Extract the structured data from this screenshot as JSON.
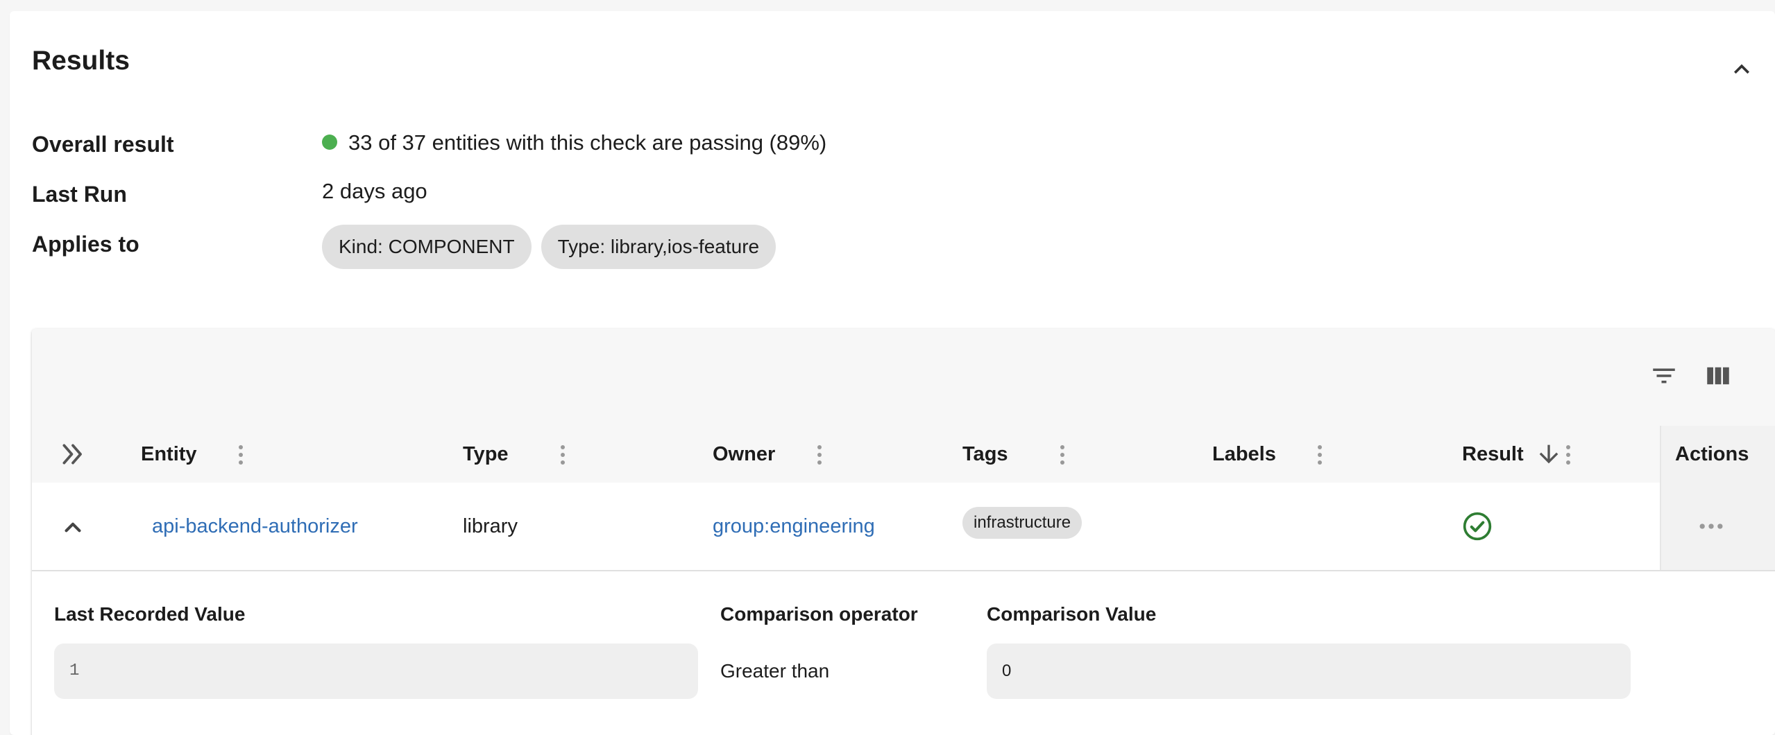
{
  "results": {
    "title": "Results",
    "collapse_icon": "chevron-up-icon"
  },
  "summary": {
    "overall_result_label": "Overall result",
    "overall_result_value": "33 of 37 entities with this check are passing (89%)",
    "status_color": "#4caf50",
    "last_run_label": "Last Run",
    "last_run_value": "2 days ago",
    "applies_to_label": "Applies to",
    "applies_to_chips": [
      "Kind: COMPONENT",
      "Type: library,ios-feature"
    ]
  },
  "toolbar": {
    "filter_icon": "filter-icon",
    "columns_icon": "view-columns-icon"
  },
  "table": {
    "expand_all_icon": "double-chevron-right-icon",
    "columns": {
      "entity": "Entity",
      "type": "Type",
      "owner": "Owner",
      "tags": "Tags",
      "labels": "Labels",
      "result": "Result",
      "actions": "Actions"
    },
    "sort_icon": "arrow-down-icon",
    "rows": [
      {
        "entity": "api-backend-authorizer",
        "type": "library",
        "owner": "group:engineering",
        "tags": [
          "infrastructure"
        ],
        "labels": "",
        "result_icon": "check-circle-icon",
        "result_color": "#2e7d32",
        "actions_icon": "more-horizontal-icon"
      }
    ],
    "detail": {
      "last_recorded_value_label": "Last Recorded Value",
      "last_recorded_value": "1",
      "comparison_operator_label": "Comparison operator",
      "comparison_operator": "Greater than",
      "comparison_value_label": "Comparison Value",
      "comparison_value": "0"
    }
  }
}
